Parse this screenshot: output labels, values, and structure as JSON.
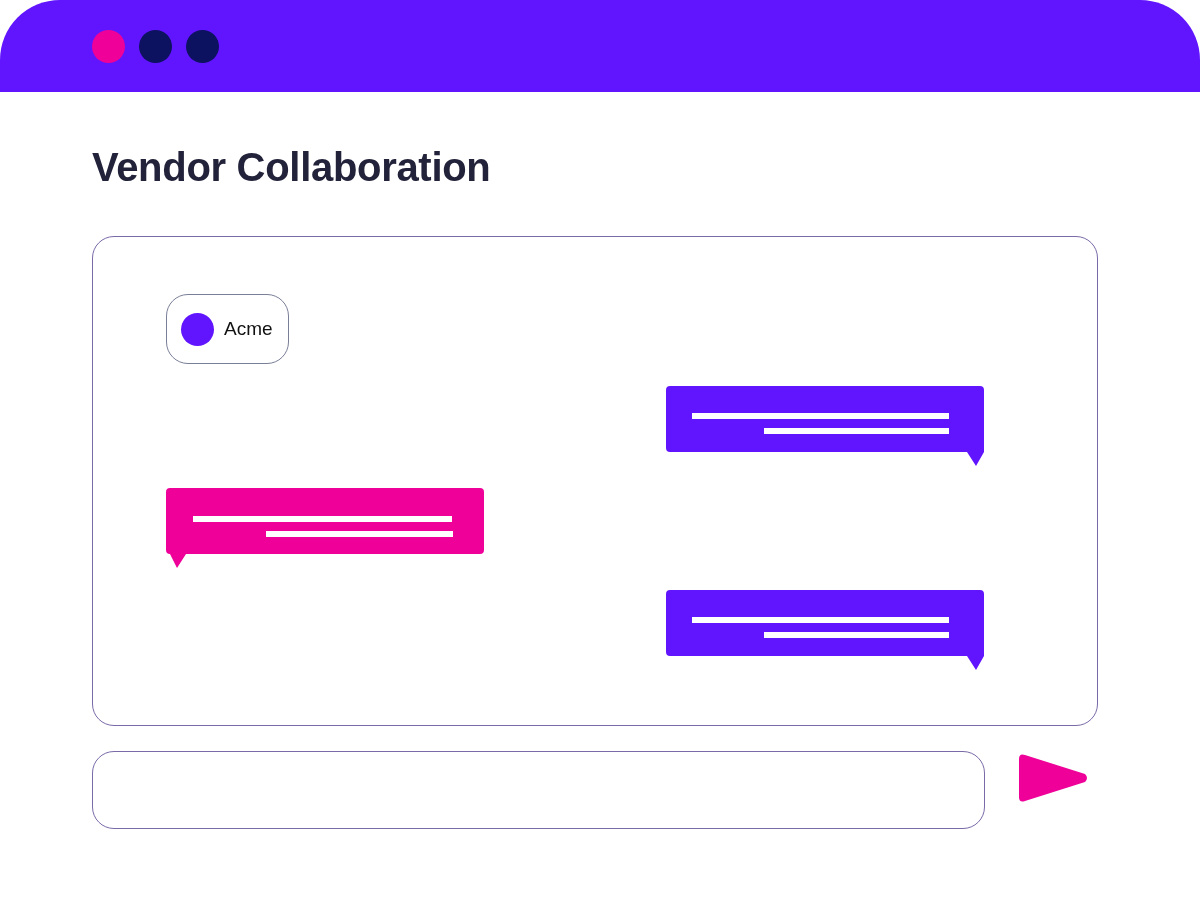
{
  "window": {
    "controls": [
      {
        "color": "#ee0099"
      },
      {
        "color": "#0c1160"
      },
      {
        "color": "#0c1160"
      }
    ]
  },
  "title": "Vendor Collaboration",
  "chat": {
    "participant": {
      "name": "Acme"
    },
    "messages": [
      {
        "outgoing": true,
        "color": "#6115ff"
      },
      {
        "outgoing": false,
        "color": "#ee0099"
      },
      {
        "outgoing": true,
        "color": "#6115ff"
      }
    ]
  }
}
